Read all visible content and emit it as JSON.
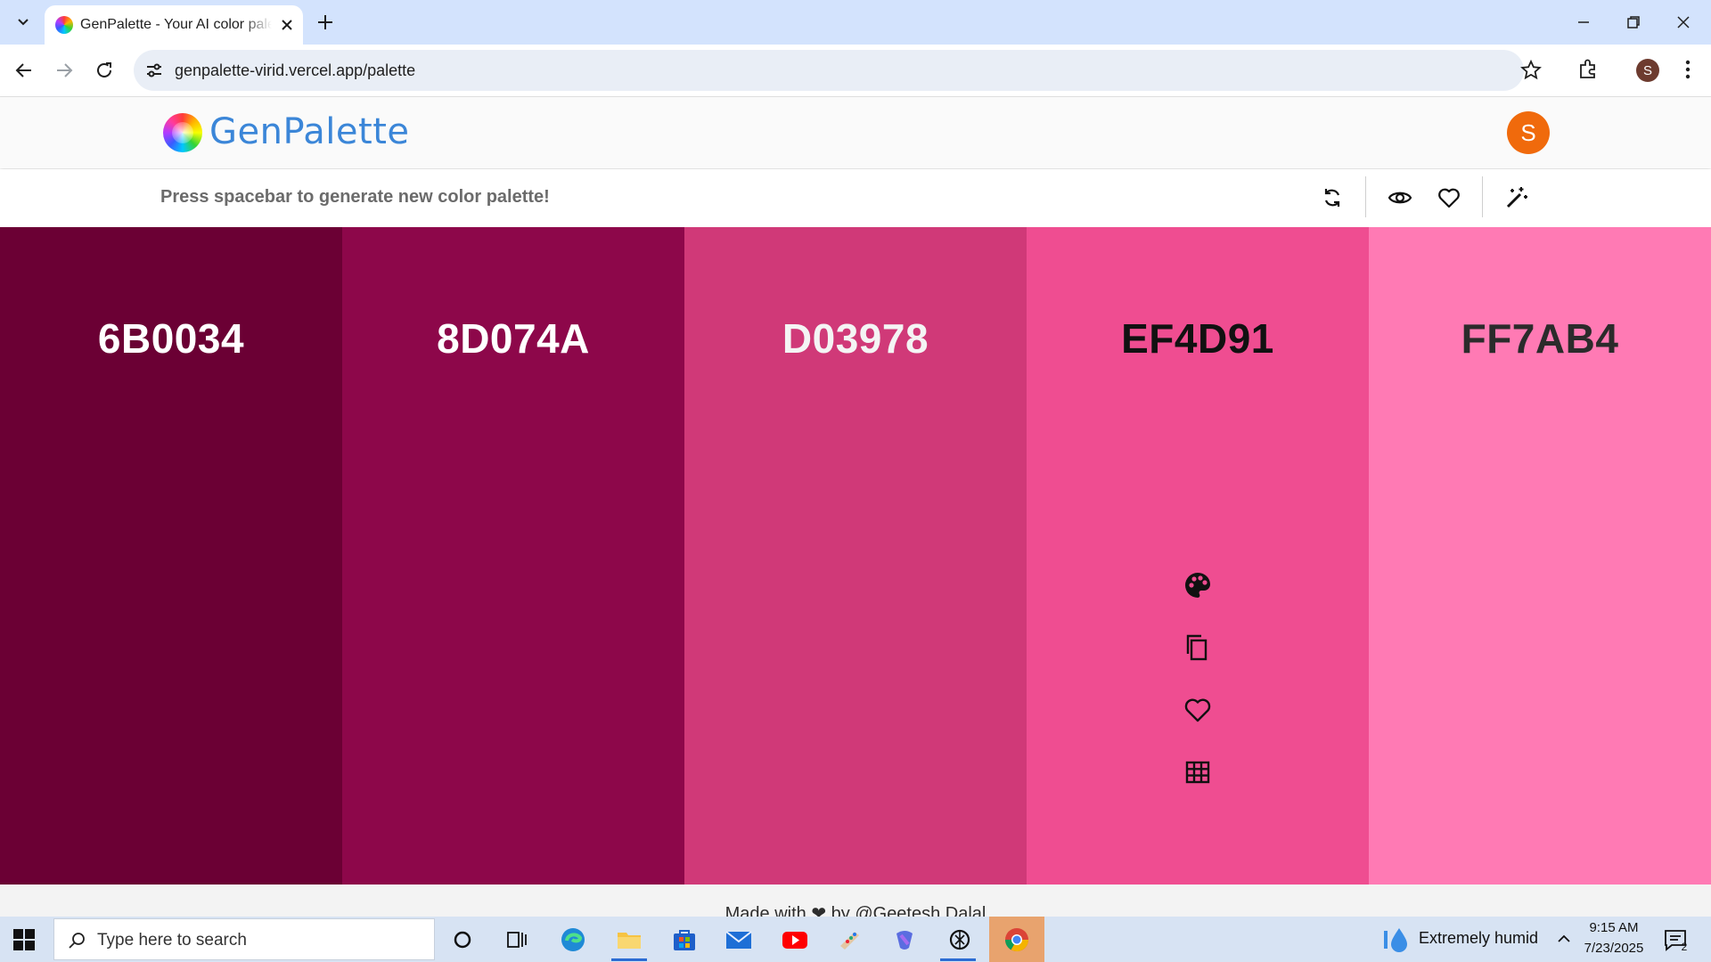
{
  "browser": {
    "tab_title": "GenPalette - Your AI color palette generator",
    "url": "genpalette-virid.vercel.app/palette",
    "profile_initial": "S"
  },
  "app": {
    "logo_text": "GenPalette",
    "user_initial": "S",
    "hint": "Press spacebar to generate new color palette!",
    "footer_text": "Made with ❤ by @Geetesh Dalal"
  },
  "palette": {
    "colors": [
      {
        "hex": "6B0034",
        "bg": "#6B0034",
        "text_color": "#ffffff"
      },
      {
        "hex": "8D074A",
        "bg": "#8D074A",
        "text_color": "#ffffff"
      },
      {
        "hex": "D03978",
        "bg": "#D03978",
        "text_color": "#f4f4f4"
      },
      {
        "hex": "EF4D91",
        "bg": "#EF4D91",
        "text_color": "#111111"
      },
      {
        "hex": "FF7AB4",
        "bg": "#FF7AB4",
        "text_color": "#2b2b2b"
      }
    ],
    "hovered_index": 3,
    "hover_tools": [
      "palette-icon",
      "copy-icon",
      "heart-icon",
      "grid-icon"
    ]
  },
  "taskbar": {
    "search_placeholder": "Type here to search",
    "weather": "Extremely humid",
    "time": "9:15 AM",
    "date": "7/23/2025",
    "notifications": "2"
  }
}
